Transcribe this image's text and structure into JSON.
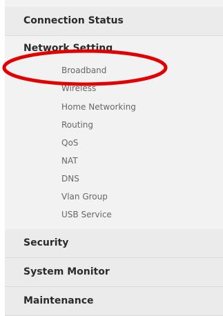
{
  "nav": {
    "connection_status": "Connection Status",
    "network_setting": "Network Setting",
    "network_items": [
      "Broadband",
      "Wireless",
      "Home Networking",
      "Routing",
      "QoS",
      "NAT",
      "DNS",
      "Vlan Group",
      "USB Service"
    ],
    "security": "Security",
    "system_monitor": "System Monitor",
    "maintenance": "Maintenance"
  },
  "annotation": {
    "highlight_target": "Broadband",
    "highlight_color": "#e30000"
  },
  "colors": {
    "panel_bg": "#f2f2f2",
    "header_bg": "#ebebeb",
    "text_dark": "#2b2b2b",
    "text_sub": "#666666"
  }
}
